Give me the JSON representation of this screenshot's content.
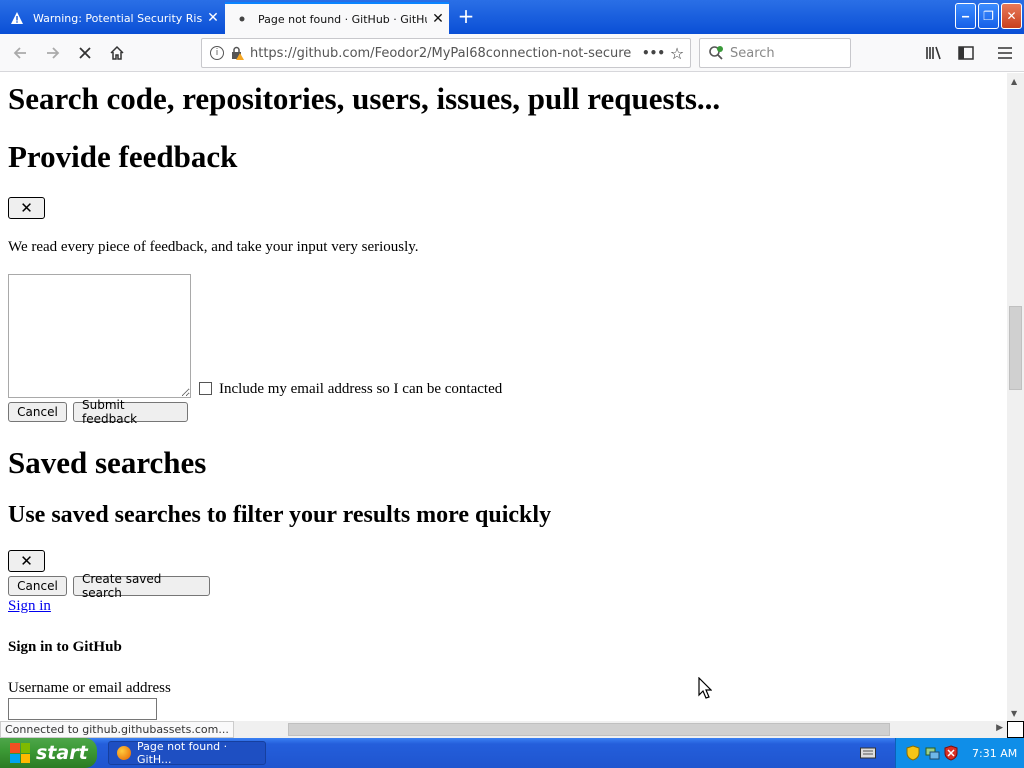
{
  "browser": {
    "tabs": [
      {
        "title": "Warning: Potential Security Risk Ah",
        "active": false,
        "icon": "warning-icon"
      },
      {
        "title": "Page not found · GitHub · GitHub",
        "active": true,
        "icon": "loading-dot-icon"
      }
    ],
    "url": "https://github.com/Feodor2/MyPal68connection-not-secure",
    "search_placeholder": "Search",
    "status_text": "Connected to github.githubassets.com..."
  },
  "page": {
    "search_heading": "Search code, repositories, users, issues, pull requests...",
    "feedback": {
      "heading": "Provide feedback",
      "close_label": "✕",
      "description": "We read every piece of feedback, and take your input very seriously.",
      "include_email_label": "Include my email address so I can be contacted",
      "cancel_label": "Cancel",
      "submit_label": "Submit feedback"
    },
    "saved_searches": {
      "heading": "Saved searches",
      "subheading": "Use saved searches to filter your results more quickly",
      "close_label": "✕",
      "cancel_label": "Cancel",
      "create_label": "Create saved search"
    },
    "sign_in_link": "Sign in",
    "sign_in_heading": "Sign in to GitHub",
    "username_label": "Username or email address"
  },
  "taskbar": {
    "start_label": "start",
    "task_label": "Page not found · GitH...",
    "clock": "7:31 AM"
  },
  "colors": {
    "xp_blue": "#245edb",
    "start_green": "#3c9a36",
    "link": "#0000ee"
  }
}
